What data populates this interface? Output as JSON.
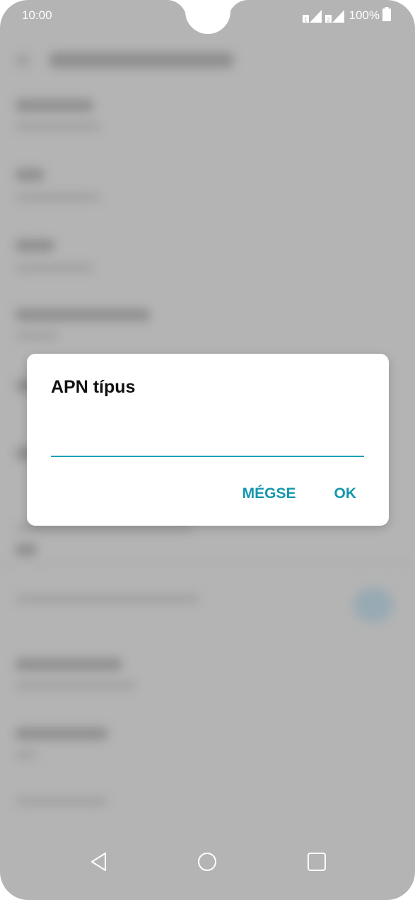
{
  "status_bar": {
    "time": "10:00",
    "battery_percent": "100%",
    "icons": [
      "sim1-signal-icon",
      "sim2-signal-icon",
      "battery-icon"
    ]
  },
  "dialog": {
    "title": "APN típus",
    "input_value": "",
    "cancel_label": "MÉGSE",
    "ok_label": "OK"
  },
  "nav_bar": {
    "icons": [
      "back-icon",
      "home-icon",
      "recents-icon"
    ]
  },
  "colors": {
    "accent": "#1597ad",
    "scrim": "#b4b4b4",
    "dialog_bg": "#ffffff"
  }
}
